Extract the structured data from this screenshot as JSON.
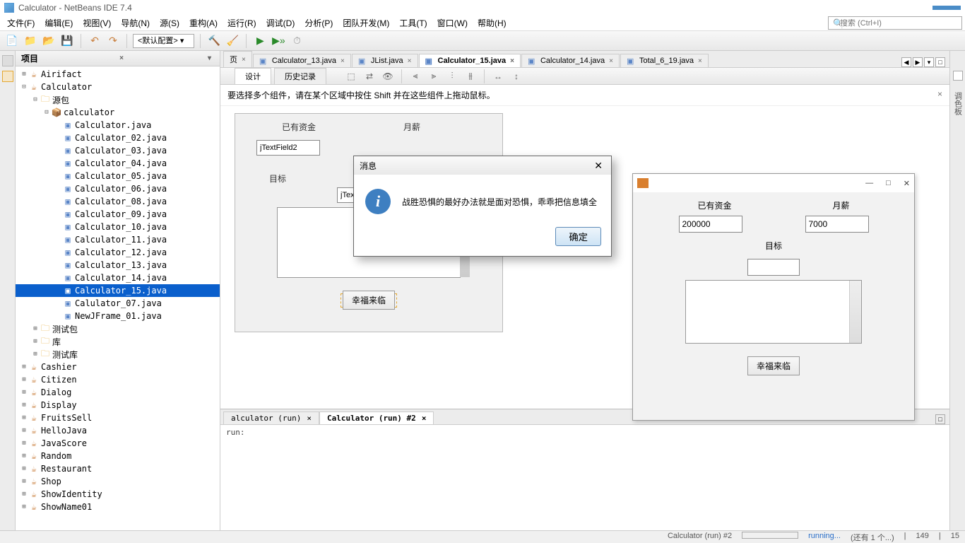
{
  "app_title": "Calculator - NetBeans IDE 7.4",
  "menus": {
    "file": "文件(F)",
    "edit": "编辑(E)",
    "view": "视图(V)",
    "nav": "导航(N)",
    "source": "源(S)",
    "refactor": "重构(A)",
    "run": "运行(R)",
    "debug": "调试(D)",
    "analyze": "分析(P)",
    "team": "团队开发(M)",
    "tools": "工具(T)",
    "window": "窗口(W)",
    "help": "帮助(H)"
  },
  "search_placeholder": "搜索 (Ctrl+I)",
  "config_label": "<默认配置>",
  "project_panel_title": "项目",
  "tree": {
    "airifact": "Airifact",
    "calculator": "Calculator",
    "srcpkg": "源包",
    "pkgname": "calculator",
    "files": [
      "Calculator.java",
      "Calculator_02.java",
      "Calculator_03.java",
      "Calculator_04.java",
      "Calculator_05.java",
      "Calculator_06.java",
      "Calculator_08.java",
      "Calculator_09.java",
      "Calculator_10.java",
      "Calculator_11.java",
      "Calculator_12.java",
      "Calculator_13.java",
      "Calculator_14.java",
      "Calculator_15.java",
      "Calulator_07.java",
      "NewJFrame_01.java"
    ],
    "testpkg": "测试包",
    "lib": "库",
    "testlib": "测试库",
    "others": [
      "Cashier",
      "Citizen",
      "Dialog",
      "Display",
      "FruitsSell",
      "HelloJava",
      "JavaScore",
      "Random",
      "Restaurant",
      "Shop",
      "ShowIdentity",
      "ShowName01"
    ]
  },
  "editor_tabs": {
    "t0": "页",
    "t1": "Calculator_13.java",
    "t2": "JList.java",
    "t3": "Calculator_15.java",
    "t4": "Calculator_14.java",
    "t5": "Total_6_19.java"
  },
  "sub_tabs": {
    "design": "设计",
    "history": "历史记录"
  },
  "hint_text": "要选择多个组件，请在某个区域中按住 Shift 并在这些组件上拖动鼠标。",
  "form": {
    "label_funds": "已有资金",
    "label_salary": "月薪",
    "label_target": "目标",
    "field1": "jTextField2",
    "field2": "jTextField3",
    "button": "幸福来临"
  },
  "dialog": {
    "title": "消息",
    "message": "战胜恐惧的最好办法就是面对恐惧，乖乖把信息填全",
    "ok": "确定"
  },
  "java_app": {
    "label_funds": "已有资金",
    "label_salary": "月薪",
    "label_target": "目标",
    "val_funds": "200000",
    "val_salary": "7000",
    "button": "幸福来临"
  },
  "output": {
    "tab1": "alculator (run)",
    "tab2": "Calculator (run) #2",
    "body": "run:"
  },
  "status": {
    "task": "Calculator (run) #2",
    "running": "running...",
    "more": "(还有 1 个...)",
    "line": "149",
    "col": "15"
  },
  "right_labels": {
    "palette": "调色板"
  }
}
